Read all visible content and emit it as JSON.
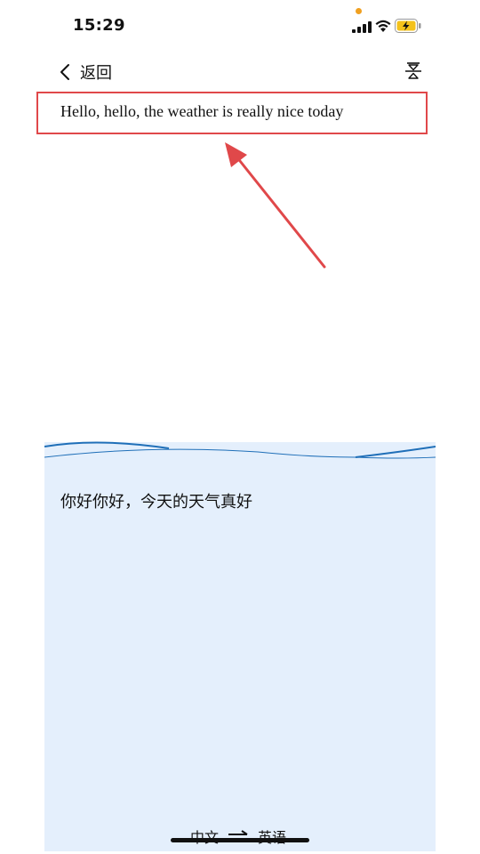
{
  "status_bar": {
    "time": "15:29",
    "icons": [
      "signal-icon",
      "wifi-icon",
      "battery-charging-icon"
    ],
    "privacy_dot_color": "#f0a020",
    "battery_color": "#f4c21b"
  },
  "nav": {
    "back_label": "返回",
    "back_icon": "chevron-left-icon",
    "right_icon": "collapse-icon"
  },
  "result": {
    "text": "Hello, hello, the weather is really nice today",
    "highlight_color": "#e0484a"
  },
  "annotation": {
    "arrow_color": "#e0484a"
  },
  "input": {
    "text": "你好你好，今天的天气真好",
    "panel_color": "#e4effc",
    "wave_color": "#1f6fb8"
  },
  "language": {
    "source": "中文",
    "target": "英语",
    "swap_icon": "arrow-right-icon"
  }
}
